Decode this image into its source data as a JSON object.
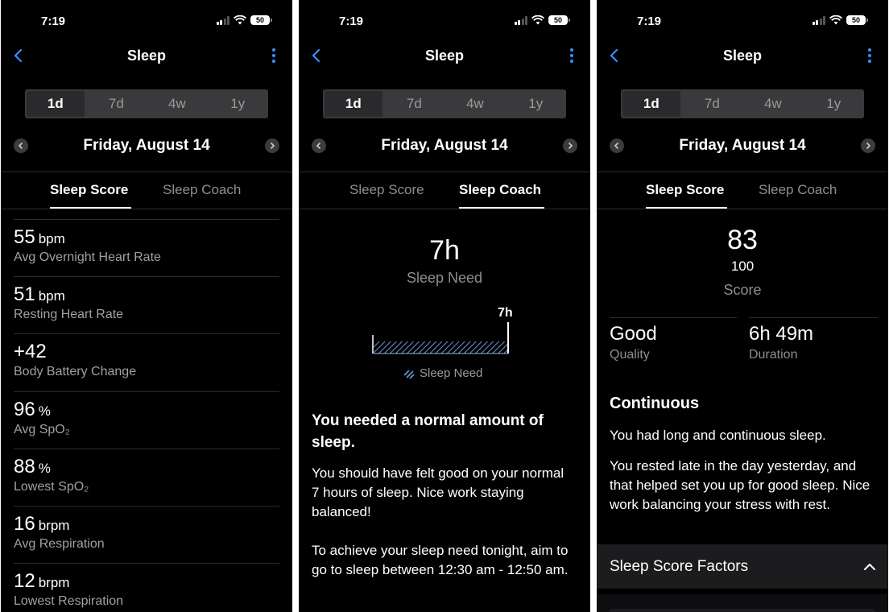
{
  "status": {
    "time": "7:19",
    "battery": "50"
  },
  "nav": {
    "title": "Sleep"
  },
  "range_tabs": [
    "1d",
    "7d",
    "4w",
    "1y"
  ],
  "date": "Friday, August 14",
  "content_tabs": [
    "Sleep Score",
    "Sleep Coach"
  ],
  "metrics": [
    {
      "value": "55",
      "unit": "bpm",
      "label": "Avg Overnight Heart Rate"
    },
    {
      "value": "51",
      "unit": "bpm",
      "label": "Resting Heart Rate"
    },
    {
      "value": "+42",
      "unit": "",
      "label": "Body Battery Change"
    },
    {
      "value": "96",
      "unit": "%",
      "label": "Avg SpO₂"
    },
    {
      "value": "88",
      "unit": "%",
      "label": "Lowest SpO₂"
    },
    {
      "value": "16",
      "unit": "brpm",
      "label": "Avg Respiration"
    },
    {
      "value": "12",
      "unit": "brpm",
      "label": "Lowest Respiration"
    }
  ],
  "coach": {
    "need_value": "7h",
    "need_label": "Sleep Need",
    "bar_marker": "7h",
    "legend_label": "Sleep Need",
    "headline": "You needed a normal amount of sleep.",
    "para1": "You should have felt good on your normal 7 hours of sleep. Nice work staying balanced!",
    "para2": "To achieve your sleep need tonight, aim to go to sleep between 12:30 am - 12:50 am."
  },
  "score": {
    "value": "83",
    "max": "100",
    "label": "Score",
    "quality_value": "Good",
    "quality_label": "Quality",
    "duration_value": "6h 49m",
    "duration_label": "Duration",
    "section_title": "Continuous",
    "para1": "You had long and continuous sleep.",
    "para2": "You rested late in the day yesterday, and that helped set you up for good sleep. Nice work balancing your stress with rest.",
    "factors_label": "Sleep Score Factors"
  },
  "colors": {
    "accent": "#3a8fff",
    "background": "#000000",
    "segment": "#3a3a3c",
    "bar_hatch": "#6f93d6"
  }
}
